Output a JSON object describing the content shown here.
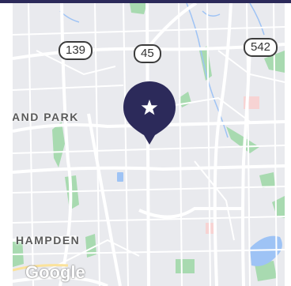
{
  "colors": {
    "frame": "#2c2a5a",
    "land": "#e9eaee",
    "road": "#ffffff",
    "park": "#a8dab0",
    "water": "#9ec3f5",
    "marker": "#2c2a5a",
    "hospital": "#f7d3d3",
    "highway": "#fbe29a"
  },
  "map": {
    "route_shields": [
      "139",
      "45",
      "542"
    ],
    "place_labels": [
      "AND PARK",
      "HAMPDEN"
    ],
    "marker_icon": "star-icon",
    "attribution": "Google"
  }
}
